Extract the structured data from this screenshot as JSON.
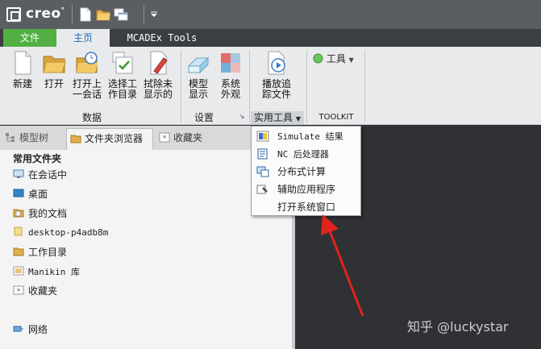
{
  "titlebar": {
    "app_name": "creo",
    "app_name_mark": "°"
  },
  "ribbon_tabs": {
    "file": "文件",
    "home": "主页",
    "mcadex": "MCADEx Tools"
  },
  "ribbon": {
    "new": "新建",
    "open": "打开",
    "open_last_l1": "打开上",
    "open_last_l2": "一会话",
    "select_wd_l1": "选择工",
    "select_wd_l2": "作目录",
    "erase_l1": "拭除未",
    "erase_l2": "显示的",
    "model_display_l1": "模型",
    "model_display_l2": "显示",
    "system_appearance_l1": "系统",
    "system_appearance_l2": "外观",
    "play_trail_l1": "播放追",
    "play_trail_l2": "踪文件",
    "tools_menu": "工具",
    "groups": {
      "data": "数据",
      "settings": "设置",
      "utilities": "实用工具",
      "toolkit": "TOOLKIT"
    }
  },
  "navigator": {
    "tabs": {
      "model_tree": "模型树",
      "folder_browser": "文件夹浏览器",
      "favorites": "收藏夹"
    },
    "heading": "常用文件夹",
    "items": [
      "在会话中",
      "桌面",
      "我的文档",
      "desktop-p4adb8m",
      "工作目录",
      "Manikin 库",
      "收藏夹"
    ],
    "network": "网络"
  },
  "dropdown": {
    "items": [
      "Simulate 结果",
      "NC 后处理器",
      "分布式计算",
      "辅助应用程序",
      "打开系统窗口"
    ]
  },
  "watermark": "知乎 @luckystar"
}
